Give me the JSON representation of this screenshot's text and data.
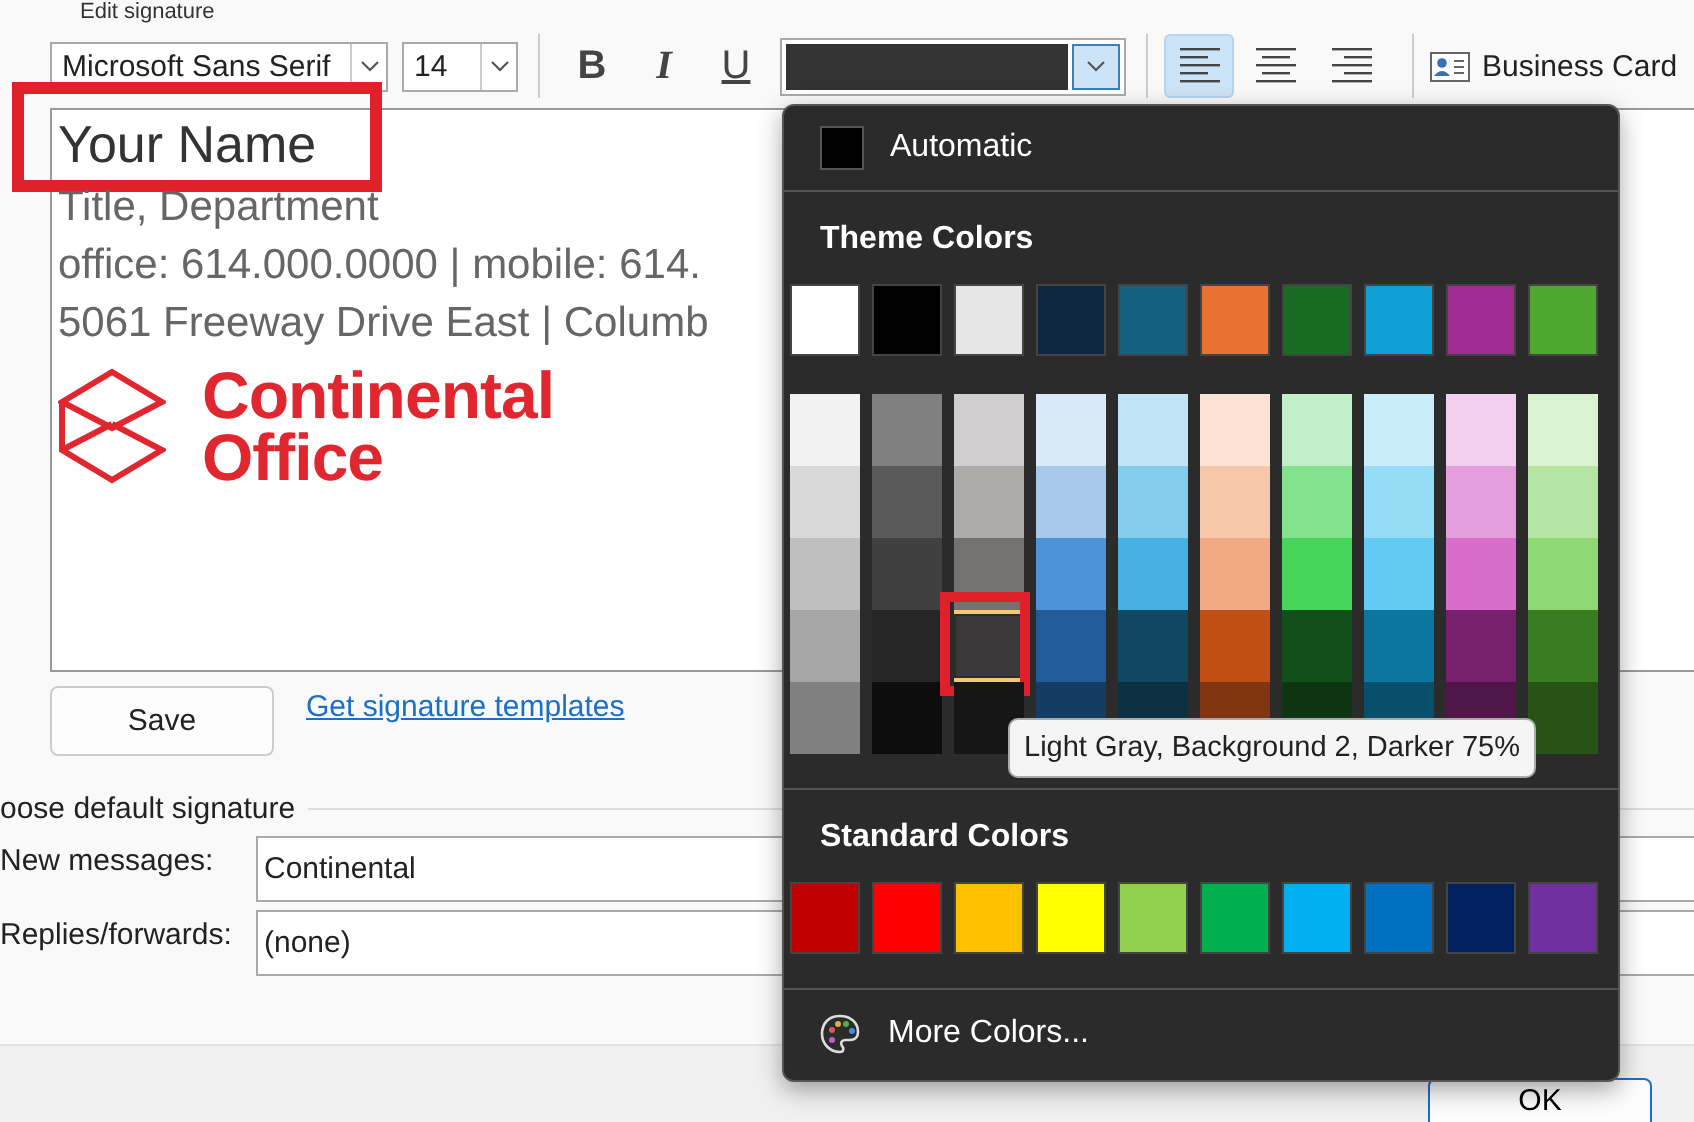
{
  "section_label": "Edit signature",
  "toolbar": {
    "font": "Microsoft Sans Serif",
    "size": "14",
    "format_buttons": [
      {
        "kind": "bold",
        "label": "B",
        "selected": false
      },
      {
        "kind": "italic",
        "label": "I",
        "selected": false
      },
      {
        "kind": "underline",
        "label": "U",
        "selected": false
      }
    ],
    "font_color": {
      "color": "#333333",
      "open": true
    },
    "align_buttons": [
      {
        "kind": "left",
        "selected": true
      },
      {
        "kind": "center",
        "selected": false
      },
      {
        "kind": "right",
        "selected": false
      }
    ],
    "business_card": "Business Card"
  },
  "signature": {
    "lines": [
      {
        "kind": "name",
        "text": "Your Name",
        "annotated": true
      },
      {
        "kind": "detail",
        "text": "Title, Department",
        "annotated": false
      },
      {
        "kind": "detail",
        "text": "office: 614.000.0000 | mobile: 614.",
        "annotated": false
      },
      {
        "kind": "detail",
        "text": "5061 Freeway Drive East | Columb",
        "annotated": false
      }
    ],
    "logo": {
      "line1": "Continental",
      "line2": "Office"
    }
  },
  "save_button": "Save",
  "templates_link": "Get signature templates",
  "defaults": {
    "title": "oose default signature",
    "rows": [
      {
        "label": "New messages:",
        "value": "Continental"
      },
      {
        "label": "Replies/forwards:",
        "value": "(none)"
      }
    ]
  },
  "footer": {
    "ok_button": "OK"
  },
  "color_menu": {
    "automatic": {
      "label": "Automatic",
      "color": "#000000"
    },
    "theme_heading": "Theme Colors",
    "theme_base": [
      {
        "color": "#ffffff",
        "selected": false
      },
      {
        "color": "#000000",
        "selected": false
      },
      {
        "color": "#e7e6e6",
        "selected": false
      },
      {
        "color": "#0e2841",
        "selected": false
      },
      {
        "color": "#156082",
        "selected": false
      },
      {
        "color": "#e97132",
        "selected": false
      },
      {
        "color": "#196b24",
        "selected": false
      },
      {
        "color": "#0f9ed5",
        "selected": false
      },
      {
        "color": "#a02b93",
        "selected": false
      },
      {
        "color": "#4ea72e",
        "selected": false
      }
    ],
    "theme_shades": [
      {
        "swatches": [
          {
            "color": "#f2f2f2",
            "selected": false
          },
          {
            "color": "#d9d9d9",
            "selected": false
          },
          {
            "color": "#bfbfbf",
            "selected": false
          },
          {
            "color": "#a6a6a6",
            "selected": false
          },
          {
            "color": "#808080",
            "selected": false
          }
        ]
      },
      {
        "swatches": [
          {
            "color": "#808080",
            "selected": false
          },
          {
            "color": "#595959",
            "selected": false
          },
          {
            "color": "#404040",
            "selected": false
          },
          {
            "color": "#262626",
            "selected": false
          },
          {
            "color": "#0d0d0d",
            "selected": false
          }
        ]
      },
      {
        "swatches": [
          {
            "color": "#d0cece",
            "selected": false
          },
          {
            "color": "#aeaaaa",
            "selected": false
          },
          {
            "color": "#767171",
            "selected": false
          },
          {
            "color": "#3a3838",
            "selected": true
          },
          {
            "color": "#171616",
            "selected": false
          }
        ]
      },
      {
        "swatches": [
          {
            "color": "#dae9f8",
            "selected": false
          },
          {
            "color": "#a6c9ec",
            "selected": false
          },
          {
            "color": "#4d93d9",
            "selected": false
          },
          {
            "color": "#215c98",
            "selected": false
          },
          {
            "color": "#153d64",
            "selected": false
          }
        ]
      },
      {
        "swatches": [
          {
            "color": "#c0e4f5",
            "selected": false
          },
          {
            "color": "#83cceb",
            "selected": false
          },
          {
            "color": "#45b0e1",
            "selected": false
          },
          {
            "color": "#104861",
            "selected": false
          },
          {
            "color": "#0a3041",
            "selected": false
          }
        ]
      },
      {
        "swatches": [
          {
            "color": "#fbe2d5",
            "selected": false
          },
          {
            "color": "#f7c7ac",
            "selected": false
          },
          {
            "color": "#f1a983",
            "selected": false
          },
          {
            "color": "#c04f15",
            "selected": false
          },
          {
            "color": "#803510",
            "selected": false
          }
        ]
      },
      {
        "swatches": [
          {
            "color": "#c1f0c8",
            "selected": false
          },
          {
            "color": "#83e28e",
            "selected": false
          },
          {
            "color": "#47d45a",
            "selected": false
          },
          {
            "color": "#124f1b",
            "selected": false
          },
          {
            "color": "#0d3512",
            "selected": false
          }
        ]
      },
      {
        "swatches": [
          {
            "color": "#caedfb",
            "selected": false
          },
          {
            "color": "#95dcf7",
            "selected": false
          },
          {
            "color": "#61cbf3",
            "selected": false
          },
          {
            "color": "#0b76a0",
            "selected": false
          },
          {
            "color": "#074f6a",
            "selected": false
          }
        ]
      },
      {
        "swatches": [
          {
            "color": "#f2ceef",
            "selected": false
          },
          {
            "color": "#e59edd",
            "selected": false
          },
          {
            "color": "#d86dcb",
            "selected": false
          },
          {
            "color": "#77206d",
            "selected": false
          },
          {
            "color": "#501549",
            "selected": false
          }
        ]
      },
      {
        "swatches": [
          {
            "color": "#d9f2d0",
            "selected": false
          },
          {
            "color": "#b4e5a2",
            "selected": false
          },
          {
            "color": "#8ed973",
            "selected": false
          },
          {
            "color": "#3a7c22",
            "selected": false
          },
          {
            "color": "#275317",
            "selected": false
          }
        ]
      }
    ],
    "tooltip": "Light Gray, Background 2, Darker 75%",
    "standard_heading": "Standard Colors",
    "standard": [
      {
        "color": "#c00000",
        "selected": false
      },
      {
        "color": "#ff0000",
        "selected": false
      },
      {
        "color": "#ffc000",
        "selected": false
      },
      {
        "color": "#ffff00",
        "selected": false
      },
      {
        "color": "#92d050",
        "selected": false
      },
      {
        "color": "#00b050",
        "selected": false
      },
      {
        "color": "#00b0f0",
        "selected": false
      },
      {
        "color": "#0070c0",
        "selected": false
      },
      {
        "color": "#002060",
        "selected": false
      },
      {
        "color": "#7030a0",
        "selected": false
      }
    ],
    "more_colors": "More Colors..."
  }
}
